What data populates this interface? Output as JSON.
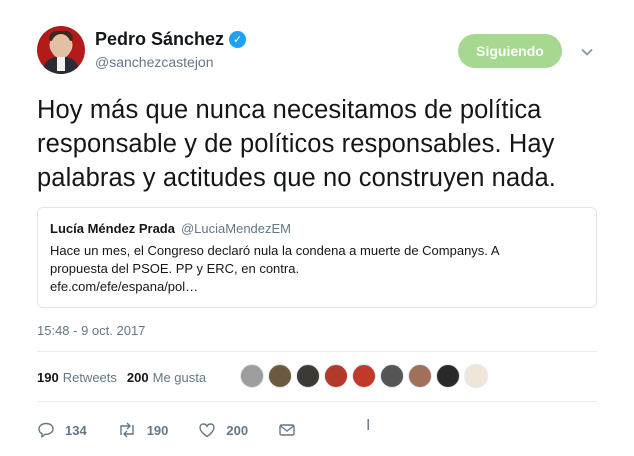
{
  "author": {
    "display_name": "Pedro Sánchez",
    "handle": "@sanchezcastejon",
    "verified": true
  },
  "follow_button": {
    "label": "Siguiendo",
    "color": "#a6d88f"
  },
  "tweet": {
    "text": "Hoy más que nunca necesitamos de política responsable y de políticos responsables. Hay palabras y actitudes que no construyen nada."
  },
  "quoted_tweet": {
    "display_name": "Lucía Méndez Prada",
    "handle": "@LuciaMendezEM",
    "text_line1": "Hace un mes, el Congreso declaró nula la condena a muerte de Companys. A",
    "text_line2": "propuesta del PSOE. PP y ERC, en contra.",
    "link": "efe.com/efe/espana/pol…"
  },
  "timestamp": "15:48 - 9 oct. 2017",
  "stats": {
    "retweets_count": "190",
    "retweets_label": "Retweets",
    "likes_count": "200",
    "likes_label": "Me gusta"
  },
  "likers": [
    {
      "color": "#9e9e9e"
    },
    {
      "color": "#6b5a3e"
    },
    {
      "color": "#3d3a35"
    },
    {
      "color": "#b23a2a"
    },
    {
      "color": "#c0392b"
    },
    {
      "color": "#555555"
    },
    {
      "color": "#a0705a"
    },
    {
      "color": "#2a2a2a"
    },
    {
      "color": "#f0e6d8"
    }
  ],
  "actions": {
    "replies": "134",
    "retweets": "190",
    "likes": "200"
  },
  "icons": [
    "verified-badge-icon",
    "chevron-down-icon",
    "reply-icon",
    "retweet-icon",
    "heart-icon",
    "mail-icon",
    "text-cursor-icon"
  ]
}
